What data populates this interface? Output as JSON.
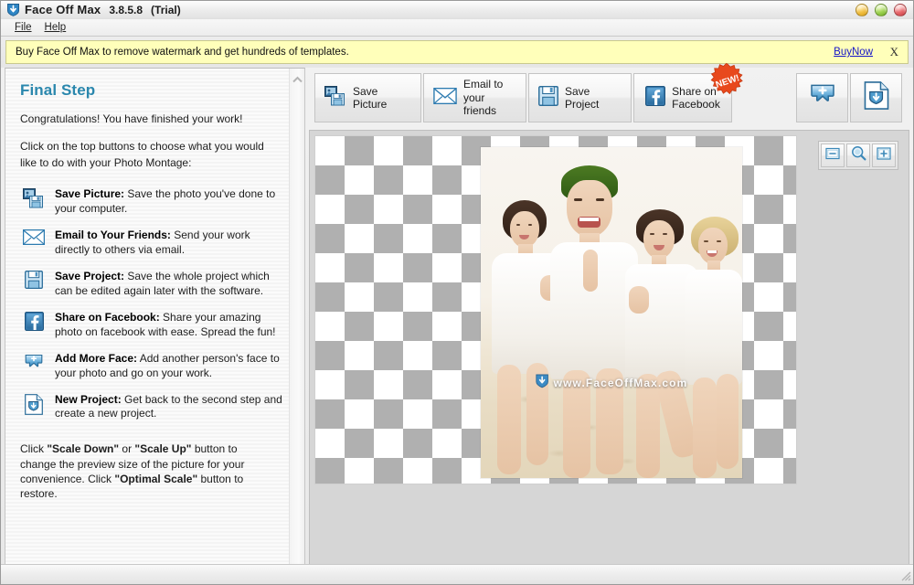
{
  "window": {
    "app_name": "Face Off Max",
    "version": "3.8.5.8",
    "edition": "(Trial)",
    "logo_icon": "shield-arrow-icon",
    "controls": {
      "minimize": "minimize-button",
      "maximize": "maximize-button",
      "close": "close-button"
    }
  },
  "menu": {
    "items": [
      {
        "label": "File"
      },
      {
        "label": "Help"
      }
    ]
  },
  "banner": {
    "text": "Buy Face Off Max to remove watermark and get hundreds of templates.",
    "link_label": "BuyNow",
    "close_label": "X"
  },
  "sidebar": {
    "heading": "Final Step",
    "congrats": "Congratulations! You have finished your work!",
    "instruction": "Click on the top buttons to choose what you would like to do with your Photo Montage:",
    "features": [
      {
        "icon": "save-picture-icon",
        "title": "Save Picture:",
        "desc": " Save the photo you've done to your computer."
      },
      {
        "icon": "envelope-icon",
        "title": "Email to Your Friends:",
        "desc": " Send your work directly to others via email."
      },
      {
        "icon": "floppy-disk-icon",
        "title": "Save Project:",
        "desc": " Save the whole project which can be edited again later with the software."
      },
      {
        "icon": "facebook-icon",
        "title": "Share on Facebook:",
        "desc": " Share your amazing photo on facebook with ease. Spread the fun!"
      },
      {
        "icon": "add-face-icon",
        "title": "Add More Face:",
        "desc": " Add another person's face to your photo and go on your work."
      },
      {
        "icon": "new-project-icon",
        "title": "New Project:",
        "desc": " Get back to the second step and create a new project."
      }
    ],
    "tip": {
      "line1_a": "Click ",
      "line1_b": "\"Scale Down\"",
      "line1_c": " or ",
      "line1_d": "\"Scale Up\"",
      "line1_e": " button to change the preview size of the picture for your convenience.",
      "line2_a": "Click ",
      "line2_b": "\"Optimal Scale\"",
      "line2_c": " button to restore."
    },
    "scroll_up_icon": "chevron-up-icon",
    "scroll_down_icon": "chevron-down-icon"
  },
  "toolbar": {
    "buttons": [
      {
        "label": "Save Picture",
        "icon": "save-picture-icon"
      },
      {
        "label": "Email to your\nfriends",
        "icon": "envelope-icon"
      },
      {
        "label": "Save Project",
        "icon": "floppy-disk-icon"
      },
      {
        "label": "Share on\nFacebook",
        "icon": "facebook-icon"
      }
    ],
    "badge": "NEW!",
    "icon_buttons": [
      {
        "name": "add-more-face-button",
        "icon": "add-face-icon"
      },
      {
        "name": "new-project-button",
        "icon": "new-project-icon"
      }
    ]
  },
  "canvas": {
    "watermark_text": "www.FaceOffMax.com",
    "watermark_icon": "shield-arrow-icon",
    "zoom_buttons": [
      {
        "name": "scale-down-button",
        "icon": "minus-box-icon"
      },
      {
        "name": "optimal-scale-button",
        "icon": "magnifier-icon"
      },
      {
        "name": "scale-up-button",
        "icon": "plus-box-icon"
      }
    ]
  },
  "statusbar": {
    "text": "",
    "resize_grip_icon": "resize-grip-icon"
  },
  "colors": {
    "accent": "#2a87ad",
    "banner_bg": "#ffffba",
    "link": "#1414c8",
    "badge": "#e8491d",
    "checker_gray": "#b0b0b0"
  }
}
